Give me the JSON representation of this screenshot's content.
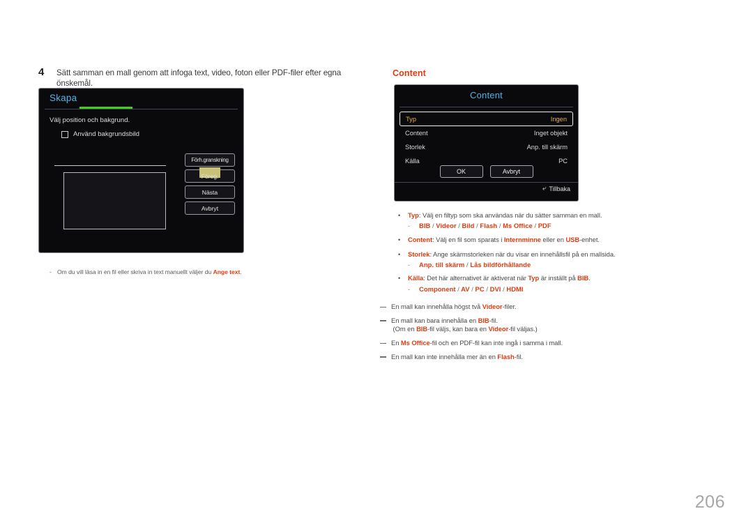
{
  "step": {
    "number": "4",
    "text": "Sätt samman en mall genom att infoga text, video, foton eller PDF-filer efter egna önskemål."
  },
  "skapa_panel": {
    "title": "Skapa",
    "instruction": "Välj position och bakgrund.",
    "checkbox_label": "Använd bakgrundsbild",
    "buttons": [
      {
        "label": "Förh.granskning",
        "highlighted": false
      },
      {
        "label": "Föreg.",
        "highlighted": true
      },
      {
        "label": "Nästa",
        "highlighted": false
      },
      {
        "label": "Avbryt",
        "highlighted": false
      }
    ]
  },
  "left_note": {
    "dash": "-",
    "prefix": "Om du vill läsa in en fil eller skriva in text manuellt väljer du ",
    "bold": "Ange text",
    "suffix": "."
  },
  "right": {
    "heading": "Content"
  },
  "content_panel": {
    "title": "Content",
    "rows": [
      {
        "label": "Typ",
        "value": "Ingen",
        "selected": true
      },
      {
        "label": "Content",
        "value": "Inget objekt",
        "selected": false
      },
      {
        "label": "Storlek",
        "value": "Anp. till skärm",
        "selected": false
      },
      {
        "label": "Källa",
        "value": "PC",
        "selected": false
      }
    ],
    "ok_label": "OK",
    "cancel_label": "Avbryt",
    "back_label": "Tillbaka",
    "back_icon": "return-arrow-icon"
  },
  "bullets": [
    {
      "term": "Typ",
      "rest": ": Välj en filtyp som ska användas när du sätter samman en mall.",
      "sub": "BIB / Videor / Bild / Flash / Ms Office / PDF"
    },
    {
      "term": "Content",
      "rest": ": Välj en fil som sparats i Internminne eller en USB-enhet.",
      "rest_html": ": Välj en fil som sparats i <b class=\"rd\">Internminne</b> eller en <b class=\"rd\">USB</b>-enhet.",
      "sub": ""
    },
    {
      "term": "Storlek",
      "rest": ": Ange skärmstorleken när du visar en innehållsfil på en mallsida.",
      "sub": "Anp. till skärm / Lås bildförhållande"
    },
    {
      "term": "Källa",
      "rest": ": Det här alternativet är aktiverat när Typ är inställt på BIB.",
      "rest_html": ": Det här alternativet är aktiverat när <b class=\"rd\">Typ</b> är inställt på <b class=\"rd\">BIB</b>.",
      "sub": "Component / AV / PC / DVI / HDMI"
    }
  ],
  "notes": [
    {
      "text": "En mall kan innehålla högst två Videor-filer.",
      "html": "En mall kan innehålla högst två <b class=\"rd\">Videor</b>-filer."
    },
    {
      "text": "En mall kan bara innehålla en BIB-fil.\n(Om en BIB-fil väljs, kan bara en Videor-fil väljas.)",
      "html": "En mall kan bara innehålla en <b class=\"rd\">BIB</b>-fil.<br>&nbsp;(Om en <b class=\"rd\">BIB</b>-fil väljs, kan bara en <b class=\"rd\">Videor</b>-fil väljas.)"
    },
    {
      "text": "En Ms Office-fil och en PDF-fil kan inte ingå i samma i mall.",
      "html": "En <b class=\"rd\">Ms Office</b>-fil och en PDF-fil kan inte ingå i samma i mall."
    },
    {
      "text": "En mall kan inte innehålla mer än en Flash-fil.",
      "html": "En mall kan inte innehålla mer än en <b class=\"rd\">Flash</b>-fil."
    }
  ],
  "page_number": "206",
  "colors": {
    "accent_red": "#e03c10",
    "osd_title_blue": "#4eb5e8",
    "osd_green": "#3fd119",
    "osd_selected_amber": "#e8b23c",
    "highlight_khaki": "#c8c178"
  }
}
